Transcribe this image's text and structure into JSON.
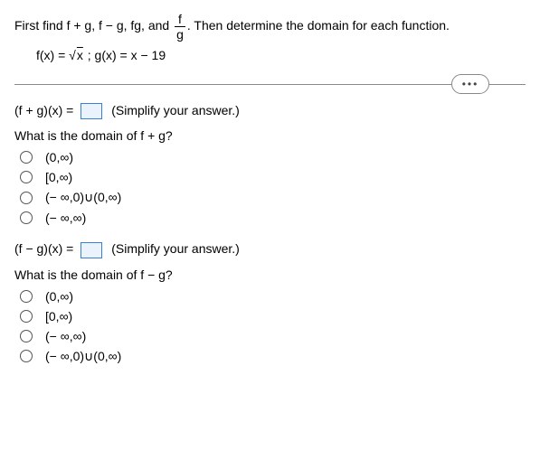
{
  "prompt": {
    "part1": "First find f + g, f − g, fg, and ",
    "frac_num": "f",
    "frac_den": "g",
    "part2": ". Then determine the domain for each function."
  },
  "given": {
    "prefix": "f(x) = ",
    "sqrt_sym": "√",
    "under": "x",
    "mid": " ; g(x) = x − 19"
  },
  "ellipsis": "•••",
  "q1": {
    "lhs": "(f + g)(x) = ",
    "hint": "(Simplify your answer.)",
    "question": "What is the domain of f + g?",
    "opts": [
      "(0,∞)",
      "[0,∞)",
      "(− ∞,0)∪(0,∞)",
      "(− ∞,∞)"
    ]
  },
  "q2": {
    "lhs": "(f − g)(x) = ",
    "hint": "(Simplify your answer.)",
    "question": "What is the domain of f − g?",
    "opts": [
      "(0,∞)",
      "[0,∞)",
      "(− ∞,∞)",
      "(− ∞,0)∪(0,∞)"
    ]
  }
}
